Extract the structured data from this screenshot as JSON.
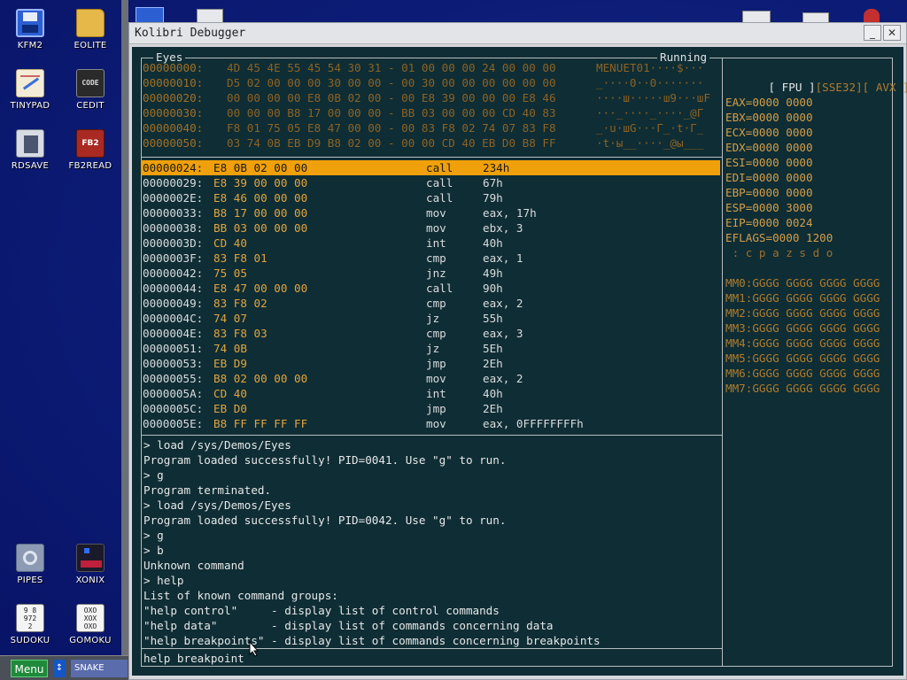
{
  "desktop": {
    "icons": [
      {
        "label": "KFM2"
      },
      {
        "label": "EOLITE"
      },
      {
        "label": "TINYPAD"
      },
      {
        "label": "CEDIT"
      },
      {
        "label": "RDSAVE"
      },
      {
        "label": "FB2READ"
      },
      {
        "label": "PIPES"
      },
      {
        "label": "XONIX"
      },
      {
        "label": "SUDOKU"
      },
      {
        "label": "GOMOKU"
      }
    ]
  },
  "taskbar": {
    "menu_label": "Menu",
    "swap_glyph": "↕",
    "task_label": "SNAKE"
  },
  "window": {
    "title": "Kolibri Debugger",
    "minimize_glyph": "_",
    "close_glyph": "✕"
  },
  "debugger": {
    "program_name": "Eyes",
    "status": "Running",
    "hexdump": [
      {
        "addr": "00000000:",
        "bytes": "4D 45 4E 55 45 54 30 31 - 01 00 00 00 24 00 00 00",
        "ascii": "MENUET01····$···"
      },
      {
        "addr": "00000010:",
        "bytes": "D5 02 00 00 00 30 00 00 - 00 30 00 00 00 00 00 00",
        "ascii": "_····0··0·······"
      },
      {
        "addr": "00000020:",
        "bytes": "00 00 00 00 E8 0B 02 00 - 00 E8 39 00 00 00 E8 46",
        "ascii": "····ш·····ш9···шF"
      },
      {
        "addr": "00000030:",
        "bytes": "00 00 00 B8 17 00 00 00 - BB 03 00 00 00 CD 40 83",
        "ascii": "···_····_····_@Г"
      },
      {
        "addr": "00000040:",
        "bytes": "F8 01 75 05 E8 47 00 00 - 00 83 F8 02 74 07 83 F8",
        "ascii": "_·u·шG···Г_·t·Г_"
      },
      {
        "addr": "00000050:",
        "bytes": "03 74 0B EB D9 B8 02 00 - 00 00 CD 40 EB D0 B8 FF",
        "ascii": "·t·ы__····_@ы___"
      }
    ],
    "disasm": [
      {
        "addr": "00000024:",
        "bytes": "E8 0B 02 00 00",
        "op": "call",
        "args": "234h",
        "selected": true
      },
      {
        "addr": "00000029:",
        "bytes": "E8 39 00 00 00",
        "op": "call",
        "args": "67h"
      },
      {
        "addr": "0000002E:",
        "bytes": "E8 46 00 00 00",
        "op": "call",
        "args": "79h"
      },
      {
        "addr": "00000033:",
        "bytes": "B8 17 00 00 00",
        "op": "mov",
        "args": "eax, 17h"
      },
      {
        "addr": "00000038:",
        "bytes": "BB 03 00 00 00",
        "op": "mov",
        "args": "ebx, 3"
      },
      {
        "addr": "0000003D:",
        "bytes": "CD 40",
        "op": "int",
        "args": "40h"
      },
      {
        "addr": "0000003F:",
        "bytes": "83 F8 01",
        "op": "cmp",
        "args": "eax, 1"
      },
      {
        "addr": "00000042:",
        "bytes": "75 05",
        "op": "jnz",
        "args": "49h"
      },
      {
        "addr": "00000044:",
        "bytes": "E8 47 00 00 00",
        "op": "call",
        "args": "90h"
      },
      {
        "addr": "00000049:",
        "bytes": "83 F8 02",
        "op": "cmp",
        "args": "eax, 2"
      },
      {
        "addr": "0000004C:",
        "bytes": "74 07",
        "op": "jz",
        "args": "55h"
      },
      {
        "addr": "0000004E:",
        "bytes": "83 F8 03",
        "op": "cmp",
        "args": "eax, 3"
      },
      {
        "addr": "00000051:",
        "bytes": "74 0B",
        "op": "jz",
        "args": "5Eh"
      },
      {
        "addr": "00000053:",
        "bytes": "EB D9",
        "op": "jmp",
        "args": "2Eh"
      },
      {
        "addr": "00000055:",
        "bytes": "B8 02 00 00 00",
        "op": "mov",
        "args": "eax, 2"
      },
      {
        "addr": "0000005A:",
        "bytes": "CD 40",
        "op": "int",
        "args": "40h"
      },
      {
        "addr": "0000005C:",
        "bytes": "EB D0",
        "op": "jmp",
        "args": "2Eh"
      },
      {
        "addr": "0000005E:",
        "bytes": "B8 FF FF FF FF",
        "op": "mov",
        "args": "eax, 0FFFFFFFFh"
      }
    ],
    "console": [
      "> load /sys/Demos/Eyes",
      "Program loaded successfully! PID=0041. Use \"g\" to run.",
      "> g",
      "Program terminated.",
      "> load /sys/Demos/Eyes",
      "Program loaded successfully! PID=0042. Use \"g\" to run.",
      "> g",
      "> b",
      "Unknown command",
      "> help",
      "List of known command groups:",
      "\"help control\"     - display list of control commands",
      "\"help data\"        - display list of commands concerning data",
      "\"help breakpoints\" - display list of commands concerning breakpoints"
    ],
    "input_value": "help breakpoint",
    "tabs": {
      "fpu": "[ FPU ]",
      "sse": "[SSE32]",
      "avx": "[ AVX ]"
    },
    "registers": [
      "EAX=0000 0000",
      "EBX=0000 0000",
      "ECX=0000 0000",
      "EDX=0000 0000",
      "ESI=0000 0000",
      "EDI=0000 0000",
      "EBP=0000 0000",
      "ESP=0000 3000",
      "EIP=0000 0024",
      "EFLAGS=0000 1200",
      " : c p a z s d o"
    ],
    "mmx": [
      "MM0:GGGG GGGG GGGG GGGG",
      "MM1:GGGG GGGG GGGG GGGG",
      "MM2:GGGG GGGG GGGG GGGG",
      "MM3:GGGG GGGG GGGG GGGG",
      "MM4:GGGG GGGG GGGG GGGG",
      "MM5:GGGG GGGG GGGG GGGG",
      "MM6:GGGG GGGG GGGG GGGG",
      "MM7:GGGG GGGG GGGG GGGG"
    ]
  }
}
